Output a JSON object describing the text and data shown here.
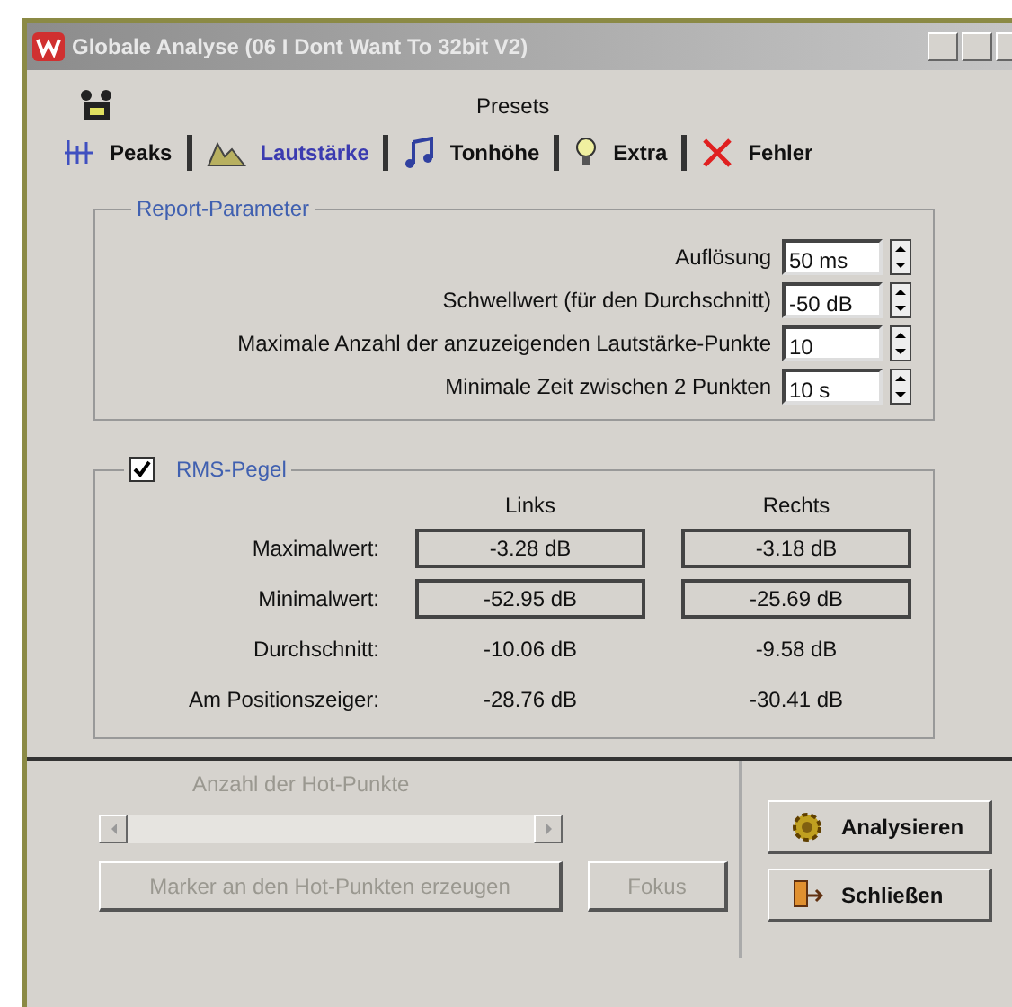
{
  "window": {
    "title": "Globale Analyse (06 I Dont Want To 32bit V2)"
  },
  "presets": {
    "label": "Presets"
  },
  "tabs": [
    {
      "label": "Peaks",
      "kind": "peaks",
      "selected": false
    },
    {
      "label": "Lautstärke",
      "kind": "volume",
      "selected": true
    },
    {
      "label": "Tonhöhe",
      "kind": "pitch",
      "selected": false
    },
    {
      "label": "Extra",
      "kind": "extra",
      "selected": false
    },
    {
      "label": "Fehler",
      "kind": "errors",
      "selected": false
    }
  ],
  "report_parameter": {
    "title": "Report-Parameter",
    "rows": [
      {
        "label": "Auflösung",
        "value": "50 ms"
      },
      {
        "label": "Schwellwert (für den Durchschnitt)",
        "value": "-50 dB"
      },
      {
        "label": "Maximale Anzahl der anzuzeigenden Lautstärke-Punkte",
        "value": "10"
      },
      {
        "label": "Minimale Zeit zwischen 2 Punkten",
        "value": "10 s"
      }
    ]
  },
  "rms": {
    "title": "RMS-Pegel",
    "checked": true,
    "columns": [
      "Links",
      "Rechts"
    ],
    "rows": [
      {
        "label": "Maximalwert:",
        "kind": "boxed",
        "left": "-3.28 dB",
        "right": "-3.18 dB"
      },
      {
        "label": "Minimalwert:",
        "kind": "boxed",
        "left": "-52.95 dB",
        "right": "-25.69 dB"
      },
      {
        "label": "Durchschnitt:",
        "kind": "plain",
        "left": "-10.06 dB",
        "right": "-9.58 dB"
      },
      {
        "label": "Am Positionszeiger:",
        "kind": "plain",
        "left": "-28.76 dB",
        "right": "-30.41 dB"
      }
    ]
  },
  "hot_points": {
    "label": "Anzahl der Hot-Punkte",
    "disabled": true
  },
  "buttons": [
    {
      "label": "Marker an den Hot-Punkten erzeugen",
      "kind": "marker",
      "disabled": true
    },
    {
      "label": "Fokus",
      "kind": "focus",
      "disabled": true
    },
    {
      "label": "Analysieren",
      "kind": "analyze",
      "disabled": false
    },
    {
      "label": "Schließen",
      "kind": "close",
      "disabled": false
    }
  ]
}
